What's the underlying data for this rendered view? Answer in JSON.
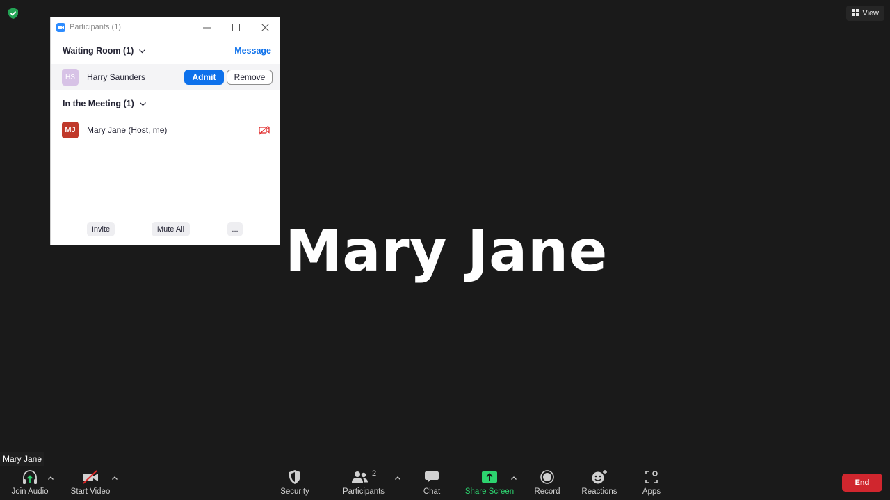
{
  "view_button": {
    "label": "View",
    "icon": "grid-icon"
  },
  "speaker": {
    "name": "Mary Jane"
  },
  "participants_panel": {
    "title": "Participants (1)",
    "waiting_room": {
      "header": "Waiting Room (1)",
      "message_label": "Message",
      "participants": [
        {
          "initials": "HS",
          "name": "Harry Saunders",
          "admit_label": "Admit",
          "remove_label": "Remove"
        }
      ]
    },
    "in_meeting": {
      "header": "In the Meeting (1)",
      "participants": [
        {
          "initials": "MJ",
          "name": "Mary Jane (Host, me)",
          "video": "off"
        }
      ]
    },
    "footer": {
      "invite_label": "Invite",
      "mute_all_label": "Mute All",
      "more_label": "..."
    }
  },
  "name_tag": "Mary Jane",
  "toolbar": {
    "join_audio": "Join Audio",
    "start_video": "Start Video",
    "security": "Security",
    "participants": "Participants",
    "participants_count": "2",
    "chat": "Chat",
    "share_screen": "Share Screen",
    "record": "Record",
    "reactions": "Reactions",
    "apps": "Apps",
    "end": "End"
  },
  "colors": {
    "background": "#1a1a1a",
    "accent_blue": "#0e71eb",
    "share_green": "#2dd36f",
    "end_red": "#d0262e"
  }
}
